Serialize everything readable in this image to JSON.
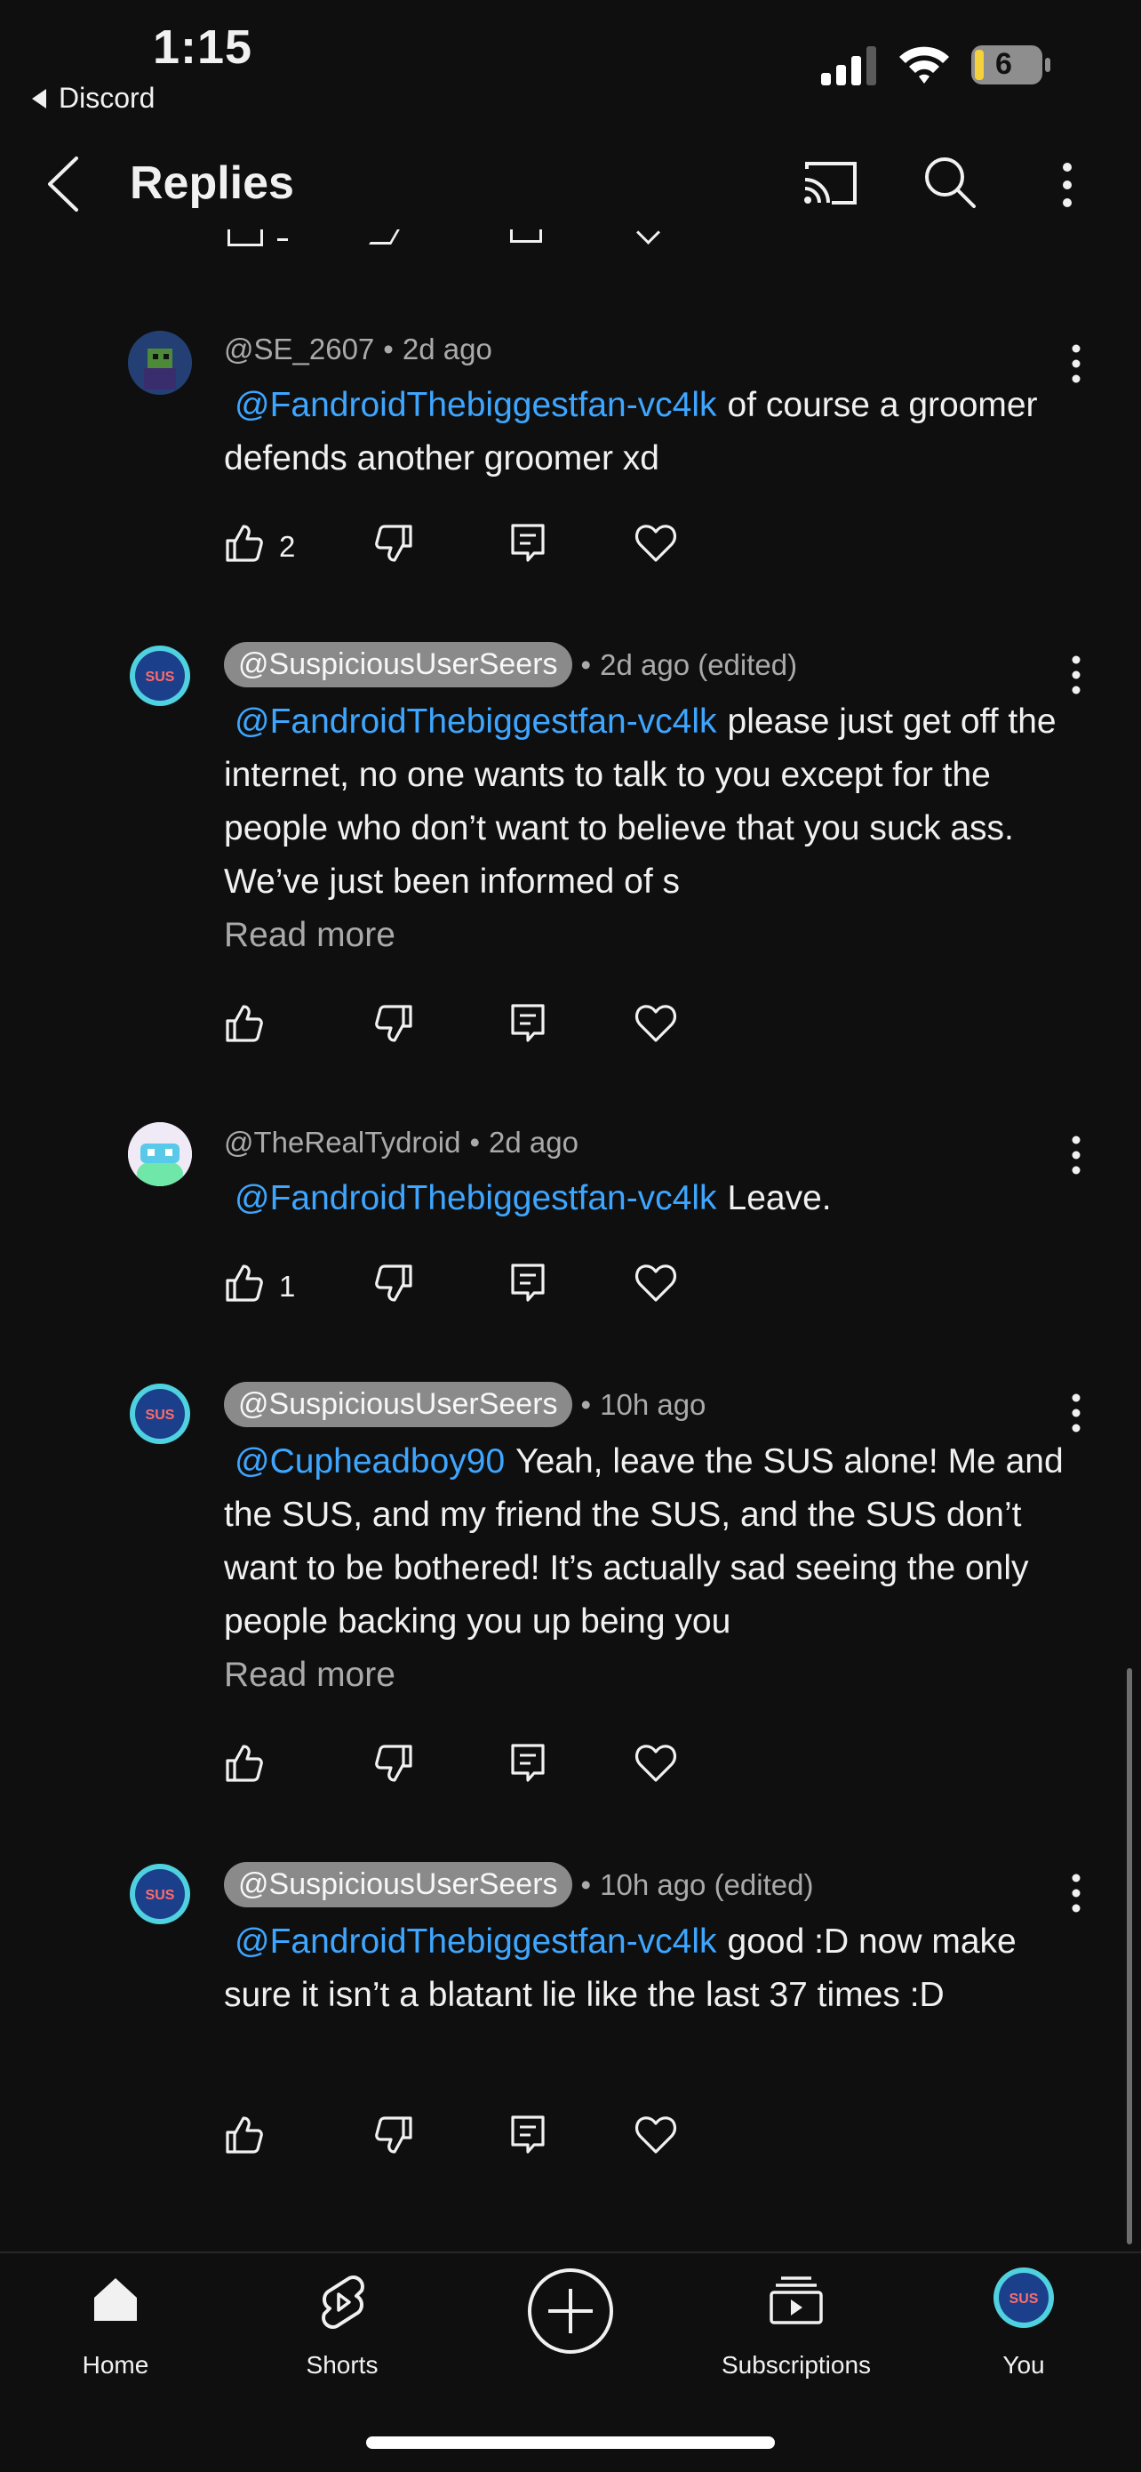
{
  "status_bar": {
    "time": "1:15",
    "back_app": "Discord",
    "battery": "6"
  },
  "header": {
    "title": "Replies"
  },
  "comments": [
    {
      "handle": "@SE_2607",
      "handle_highlighted": false,
      "age": "2d ago",
      "mention": "@FandroidThebiggestfan-vc4lk",
      "text": "of course a groomer defends another groomer xd",
      "read_more": "",
      "likes": "2"
    },
    {
      "handle": "@SuspiciousUserSeers",
      "handle_highlighted": true,
      "age": "2d ago (edited)",
      "mention": "@FandroidThebiggestfan-vc4lk",
      "text": "please just get off the internet, no one wants to talk to you except for the people who don’t want to believe that you suck ass. We’ve just been informed of s",
      "read_more": "Read more",
      "likes": ""
    },
    {
      "handle": "@TheRealTydroid",
      "handle_highlighted": false,
      "age": "2d ago",
      "mention": "@FandroidThebiggestfan-vc4lk",
      "text": "Leave.",
      "read_more": "",
      "likes": "1"
    },
    {
      "handle": "@SuspiciousUserSeers",
      "handle_highlighted": true,
      "age": "10h ago",
      "mention": "@Cupheadboy90",
      "text": "Yeah, leave the SUS alone! Me and the SUS, and my friend the SUS, and the SUS don’t want to be bothered! It’s actually sad seeing the only people backing you up being you",
      "read_more": "Read more",
      "likes": ""
    },
    {
      "handle": "@SuspiciousUserSeers",
      "handle_highlighted": true,
      "age": "10h ago (edited)",
      "mention": "@FandroidThebiggestfan-vc4lk",
      "text": "good :D now make sure it isn’t a blatant lie like the last 37 times :D",
      "read_more": "",
      "likes": ""
    }
  ],
  "nav": {
    "home": "Home",
    "shorts": "Shorts",
    "subscriptions": "Subscriptions",
    "you": "You"
  },
  "colors": {
    "mention": "#3ea6ff",
    "background": "#0f0f0f",
    "meta": "#aaaaaa"
  }
}
